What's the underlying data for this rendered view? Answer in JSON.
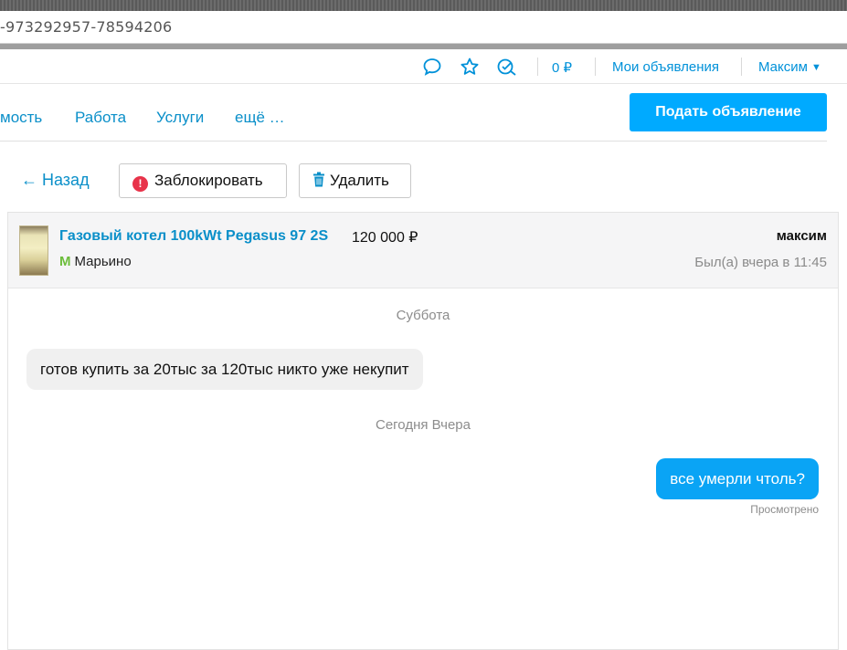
{
  "browser": {
    "url": "-973292957-78594206"
  },
  "topbar": {
    "icons": [
      "chat-icon",
      "star-icon",
      "search-history-icon"
    ],
    "balance": "0 ₽",
    "my_ads": "Мои объявления",
    "user": "Максим"
  },
  "nav": {
    "items": [
      "мость",
      "Работа",
      "Услуги",
      "ещё …"
    ],
    "post_button": "Подать объявление"
  },
  "actions": {
    "back": "← Назад",
    "block": "Заблокировать",
    "delete": "Удалить"
  },
  "chat": {
    "item_title": "Газовый котел 100kWt Pegasus 97 2S",
    "item_price": "120 000 ₽",
    "metro_station": "Марьино",
    "user_name": "максим",
    "last_seen": "Был(а) вчера в 11:45",
    "messages": [
      {
        "day": "Суббота",
        "direction": "incoming",
        "text": "готов купить за 20тыс  за 120тыс никто уже некупит"
      },
      {
        "day": "Сегодня Вчера",
        "direction": "outgoing",
        "text": "все умерли чтоль?",
        "status": "Просмотрено"
      }
    ]
  },
  "colors": {
    "accent": "#0a8fc9",
    "button": "#00aaff",
    "bubble_out": "#0aa4f5",
    "block": "#e8334a",
    "metro": "#6cbd3b"
  }
}
